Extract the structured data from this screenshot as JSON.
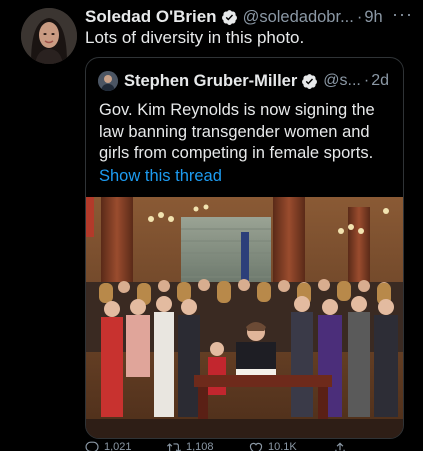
{
  "author": {
    "name": "Soledad O'Brien",
    "handle": "@soledadobr...",
    "time": "9h"
  },
  "tweet": {
    "text": "Lots of diversity in this photo."
  },
  "quoted": {
    "name": "Stephen Gruber-Miller",
    "handle": "@s...",
    "time": "2d",
    "text": "Gov. Kim Reynolds is now signing the law banning transgender women and girls from competing in female sports.",
    "link": "Show this thread"
  },
  "actions": {
    "reply": "1,021",
    "retweet": "1,108",
    "like": "10.1K"
  },
  "colors": {
    "background": "#000000",
    "text": "#e7e9ea",
    "secondary": "#8b98a5",
    "link": "#1d9bf0",
    "border": "#2f3336"
  },
  "icons": [
    "verified-badge-icon",
    "more-icon",
    "reply-icon",
    "retweet-icon",
    "like-icon",
    "share-icon"
  ]
}
